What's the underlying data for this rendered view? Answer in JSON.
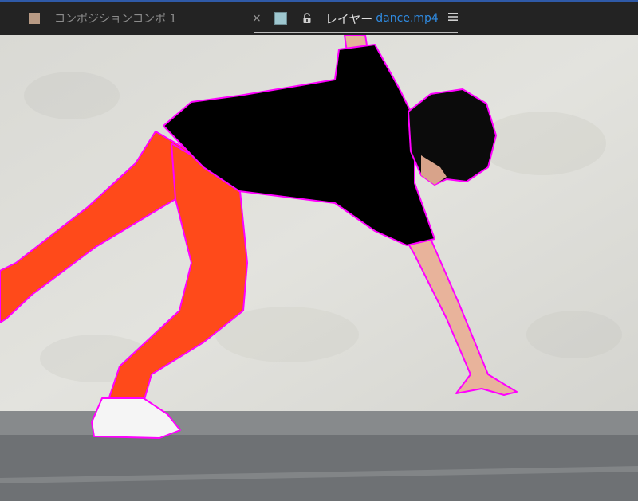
{
  "tabs": {
    "composition": {
      "label": "コンポジションコンポ 1",
      "swatch_color": "#b89a84"
    },
    "layer": {
      "close": "×",
      "swatch_color": "#9ec7cf",
      "lock_icon": "unlock-icon",
      "label": "レイヤー",
      "file": "dance.mp4",
      "menu_icon": "hamburger-menu-icon"
    }
  },
  "viewer": {
    "subject_outline_color": "#ff00ff",
    "background_wall": "#dcdcd6",
    "ground": "#6e7174"
  }
}
